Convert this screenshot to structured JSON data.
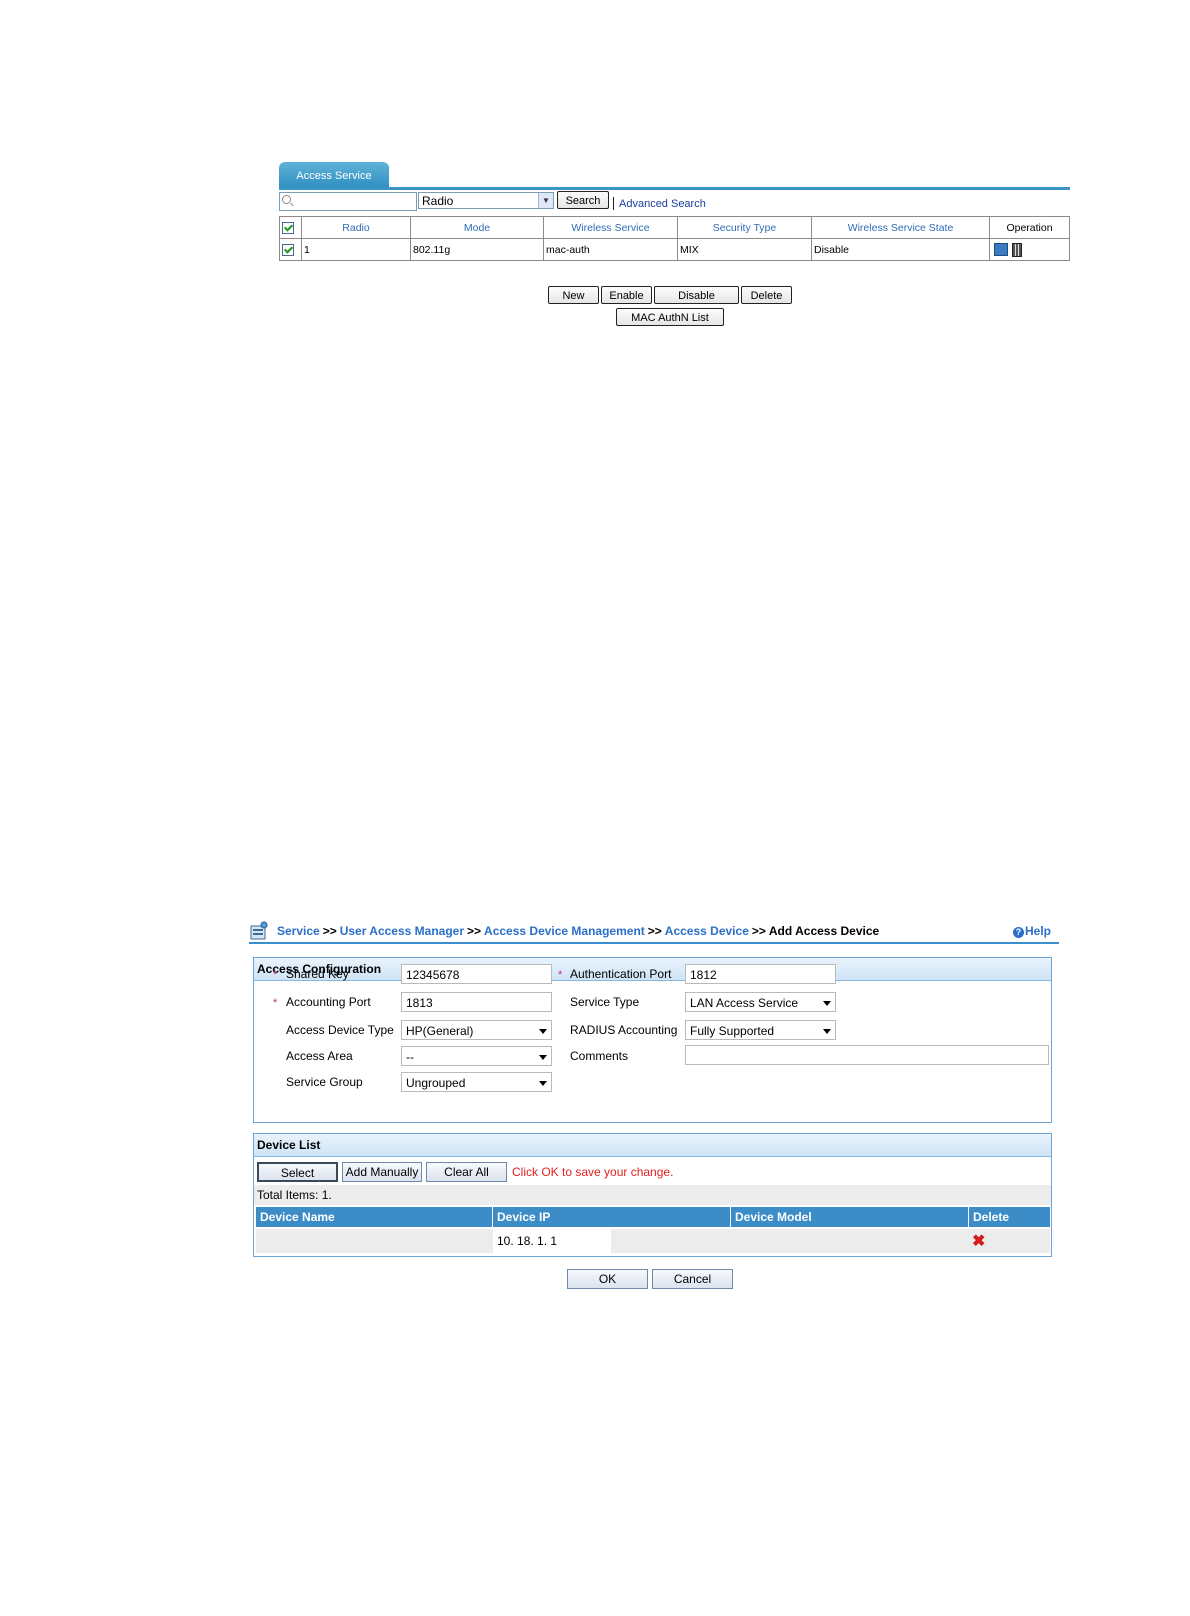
{
  "access_service": {
    "tab_label": "Access Service",
    "search": {
      "value": "",
      "field_select": "Radio",
      "button": "Search",
      "advanced_link": "Advanced Search"
    },
    "columns": [
      "Radio",
      "Mode",
      "Wireless Service",
      "Security Type",
      "Wireless Service State",
      "Operation"
    ],
    "rows": [
      {
        "checked": true,
        "radio": "1",
        "mode": "802.11g",
        "wireless_service": "mac-auth",
        "security_type": "MIX",
        "state": "Disable",
        "operation_icons": [
          "edit-icon",
          "delete-icon"
        ]
      }
    ],
    "buttons": {
      "new": "New",
      "enable": "Enable",
      "disable": "Disable",
      "delete": "Delete",
      "mac_authn_list": "MAC AuthN List"
    }
  },
  "add_access_device": {
    "breadcrumb": {
      "items": [
        "Service",
        "User Access Manager",
        "Access Device Management",
        "Access Device"
      ],
      "separator": ">>",
      "current": "Add Access Device"
    },
    "help": "Help",
    "access_configuration": {
      "title": "Access Configuration",
      "shared_key": {
        "label": "Shared Key",
        "value": "12345678",
        "required": true
      },
      "authentication_port": {
        "label": "Authentication Port",
        "value": "1812",
        "required": true
      },
      "accounting_port": {
        "label": "Accounting Port",
        "value": "1813",
        "required": true
      },
      "service_type": {
        "label": "Service Type",
        "value": "LAN Access Service"
      },
      "access_device_type": {
        "label": "Access Device Type",
        "value": "HP(General)"
      },
      "radius_accounting": {
        "label": "RADIUS Accounting",
        "value": "Fully Supported"
      },
      "access_area": {
        "label": "Access Area",
        "value": "--"
      },
      "comments": {
        "label": "Comments",
        "value": ""
      },
      "service_group": {
        "label": "Service Group",
        "value": "Ungrouped"
      }
    },
    "device_list": {
      "title": "Device List",
      "buttons": {
        "select": "Select",
        "add_manually": "Add Manually",
        "clear_all": "Clear All"
      },
      "save_message": "Click OK to save your change.",
      "total_items": "Total Items: 1.",
      "columns": [
        "Device Name",
        "Device IP",
        "Device Model",
        "Delete"
      ],
      "rows": [
        {
          "device_name": "",
          "device_ip": "10. 18. 1. 1",
          "device_model": ""
        }
      ]
    },
    "actions": {
      "ok": "OK",
      "cancel": "Cancel"
    },
    "colors": {
      "header_blue": "#3c8cc8",
      "link_blue": "#2a6fc9",
      "message_red": "#e31e1e"
    }
  }
}
